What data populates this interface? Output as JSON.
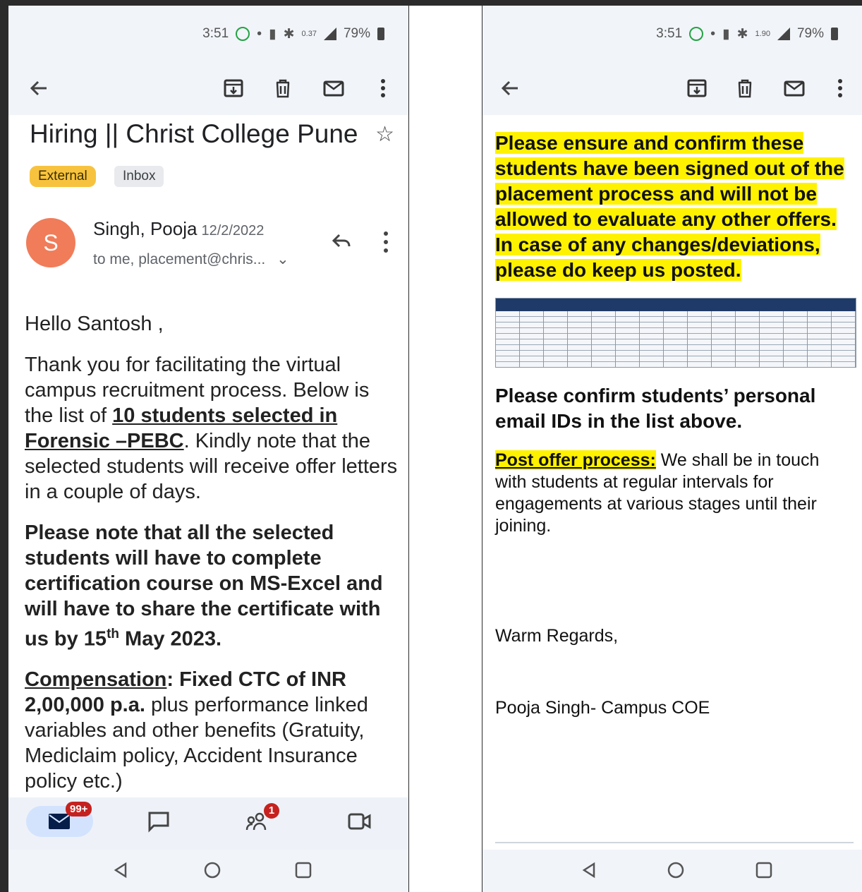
{
  "left": {
    "status": {
      "time": "3:51",
      "net_speed": "0.37",
      "battery": "79%"
    },
    "subject": "Hiring || Christ College Pune",
    "labels": {
      "external": "External",
      "inbox": "Inbox"
    },
    "sender": {
      "initial": "S",
      "name": "Singh, Pooja",
      "date": "12/2/2022",
      "recipients": "to me, placement@chris..."
    },
    "body": {
      "greeting": "Hello Santosh ,",
      "p1_a": "Thank you for facilitating the virtual campus recruitment process. Below is the list of ",
      "p1_link": "10 students selected in Forensic –PEBC",
      "p1_b": ". Kindly note that the selected students will receive offer letters in a couple of days.",
      "p2_a": "Please note that all the selected students will have to complete certification course on MS-Excel and will have to share the certificate with us by 15",
      "p2_sup": "th",
      "p2_b": " May 2023.",
      "p3_label": "Compensation",
      "p3_colon": ": ",
      "p3_bold": "Fixed CTC of INR 2,00,000 p.a.",
      "p3_rest": " plus performance linked variables and other benefits (Gratuity, Mediclaim policy, Accident Insurance policy etc.)"
    },
    "nav": {
      "mail_badge": "99+",
      "meet_badge": "1"
    }
  },
  "right": {
    "status": {
      "time": "3:51",
      "net_speed": "1.90",
      "battery": "79%"
    },
    "highlight_para": "Please ensure and confirm these students have been signed out of the placement process and will not be allowed to evaluate any other offers. In case of any changes/deviations, please do keep us posted.",
    "confirm_para": "Please confirm students’ personal email IDs in the list above.",
    "post_label": "Post offer process:",
    "post_text": " We shall be in touch with students at regular intervals for engagements at various stages until their joining.",
    "regards": "Warm Regards,",
    "signature": "Pooja Singh- Campus COE"
  },
  "colors": {
    "highlight": "#fff200",
    "external_label": "#f7c33e",
    "avatar": "#f07c5a",
    "badge": "#c5221f"
  }
}
